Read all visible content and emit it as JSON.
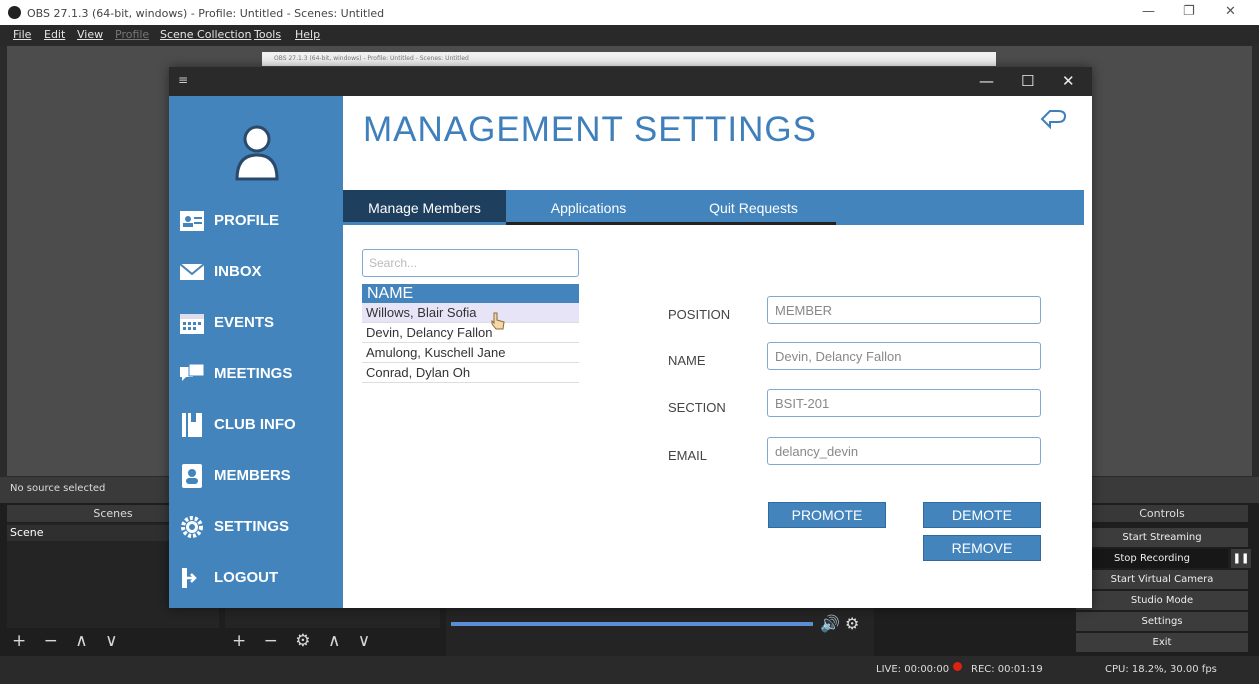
{
  "obs": {
    "title": "OBS 27.1.3 (64-bit, windows) - Profile: Untitled - Scenes: Untitled",
    "window_buttons": {
      "minimize": "—",
      "restore": "❐",
      "close": "✕"
    },
    "menu": [
      "File",
      "Edit",
      "View",
      "Profile",
      "Scene Collection",
      "Tools",
      "Help"
    ],
    "mini_window_title": "OBS 27.1.3 (64-bit, windows) - Profile: Untitled - Scenes: Untitled",
    "no_source": "No source selected",
    "scenes_header": "Scenes",
    "scene_item": "Scene",
    "controls_header": "Controls",
    "controls": [
      "Start Streaming",
      "Stop Recording",
      "Start Virtual Camera",
      "Studio Mode",
      "Settings",
      "Exit"
    ],
    "pause_label": "❚❚",
    "tools_left": "+ − ∧ ∨",
    "tools_mid": "+ − ⚙ ∧ ∨",
    "status": {
      "live": "LIVE: 00:00:00",
      "rec": "REC: 00:01:19",
      "cpu": "CPU: 18.2%, 30.00 fps"
    }
  },
  "app": {
    "window_buttons": {
      "minimize": "—",
      "maximize": "☐",
      "close": "✕"
    },
    "title": "MANAGEMENT SETTINGS",
    "nav": [
      {
        "label": "PROFILE",
        "icon": "profile-card-icon"
      },
      {
        "label": "INBOX",
        "icon": "envelope-icon"
      },
      {
        "label": "EVENTS",
        "icon": "calendar-icon"
      },
      {
        "label": "MEETINGS",
        "icon": "chat-bubbles-icon"
      },
      {
        "label": "CLUB INFO",
        "icon": "book-icon"
      },
      {
        "label": "MEMBERS",
        "icon": "member-card-icon"
      },
      {
        "label": "SETTINGS",
        "icon": "gear-icon"
      },
      {
        "label": "LOGOUT",
        "icon": "logout-icon"
      }
    ],
    "tabs": [
      "Manage Members",
      "Applications",
      "Quit Requests"
    ],
    "search_placeholder": "Search...",
    "list_header": "NAME",
    "members": [
      "Willows, Blair Sofia",
      "Devin, Delancy Fallon",
      "Amulong, Kuschell Jane",
      "Conrad, Dylan Oh"
    ],
    "fields": {
      "position": {
        "label": "POSITION",
        "value": "MEMBER"
      },
      "name": {
        "label": "NAME",
        "value": "Devin, Delancy Fallon"
      },
      "section": {
        "label": "SECTION",
        "value": "BSIT-201"
      },
      "email": {
        "label": "EMAIL",
        "value": "delancy_devin"
      }
    },
    "buttons": {
      "promote": "PROMOTE",
      "demote": "DEMOTE",
      "remove": "REMOVE"
    },
    "accent": "#4384bd"
  }
}
